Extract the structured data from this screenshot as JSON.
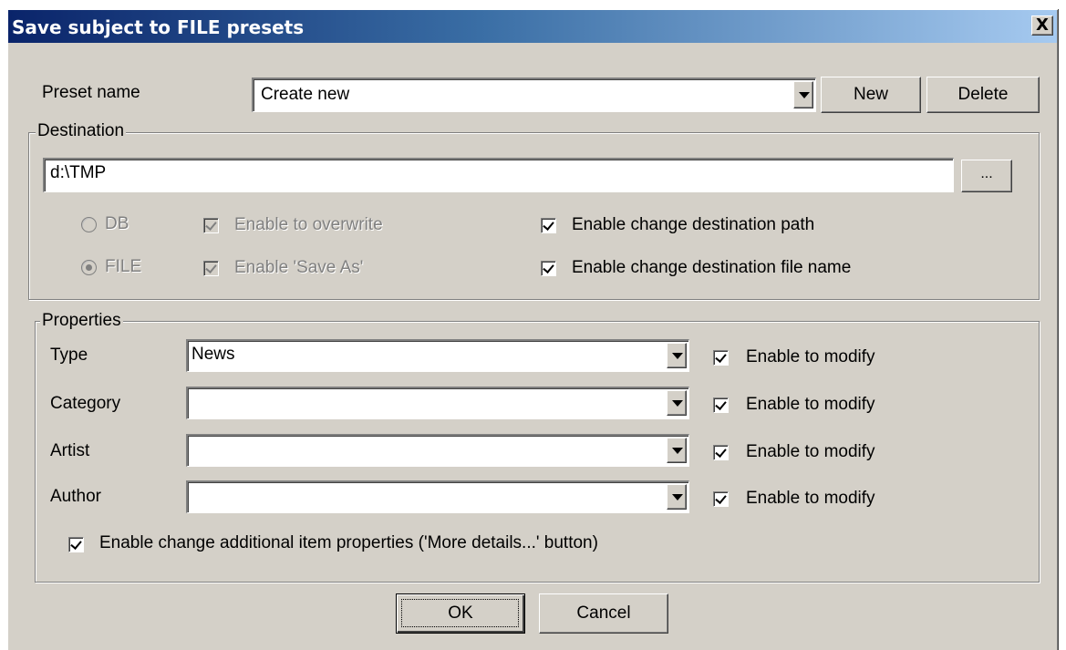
{
  "dialog": {
    "title": "Save subject to FILE presets",
    "close_glyph": "X"
  },
  "preset": {
    "label": "Preset name",
    "value": "Create new",
    "new_label": "New",
    "delete_label": "Delete"
  },
  "destination": {
    "legend": "Destination",
    "path": "d:\\TMP",
    "browse_label": "...",
    "db_label": "DB",
    "file_label": "FILE",
    "overwrite_label": "Enable to overwrite",
    "save_as_label": "Enable 'Save As'",
    "change_path_label": "Enable change destination path",
    "change_file_label": "Enable change destination file name"
  },
  "properties": {
    "legend": "Properties",
    "rows": [
      {
        "label": "Type",
        "value": "News",
        "check_label": "Enable to modify"
      },
      {
        "label": "Category",
        "value": "",
        "check_label": "Enable to modify"
      },
      {
        "label": "Artist",
        "value": "",
        "check_label": "Enable to modify"
      },
      {
        "label": "Author",
        "value": "",
        "check_label": "Enable to modify"
      }
    ],
    "additional_label": "Enable change additional item properties ('More details...' button)"
  },
  "footer": {
    "ok_label": "OK",
    "cancel_label": "Cancel"
  },
  "colors": {
    "face": "#d4d0c8",
    "title_start": "#0a246a",
    "title_end": "#a6caf0"
  }
}
